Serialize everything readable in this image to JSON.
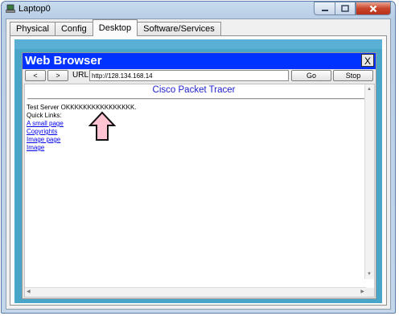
{
  "window": {
    "title": "Laptop0"
  },
  "tabs": [
    {
      "label": "Physical"
    },
    {
      "label": "Config"
    },
    {
      "label": "Desktop"
    },
    {
      "label": "Software/Services"
    }
  ],
  "active_tab": "Desktop",
  "browser": {
    "title": "Web Browser",
    "close_label": "X",
    "back_label": "<",
    "forward_label": ">",
    "url_label": "URL",
    "url_value": "http://128.134.168.14",
    "go_label": "Go",
    "stop_label": "Stop"
  },
  "page": {
    "title": "Cisco Packet Tracer",
    "status_line": "Test Server OKKKKKKKKKKKKKKKK.",
    "quick_links_heading": "Quick Links:",
    "links": [
      {
        "label": "A small page"
      },
      {
        "label": "Copyrights"
      },
      {
        "label": "Image page"
      },
      {
        "label": "Image"
      }
    ]
  },
  "colors": {
    "browser_header": "#0033ff",
    "page_title": "#1d1dcc",
    "link": "#0000ee",
    "desktop_bg": "#4aa6c8",
    "annotation_arrow_fill": "#ffc3d2"
  }
}
